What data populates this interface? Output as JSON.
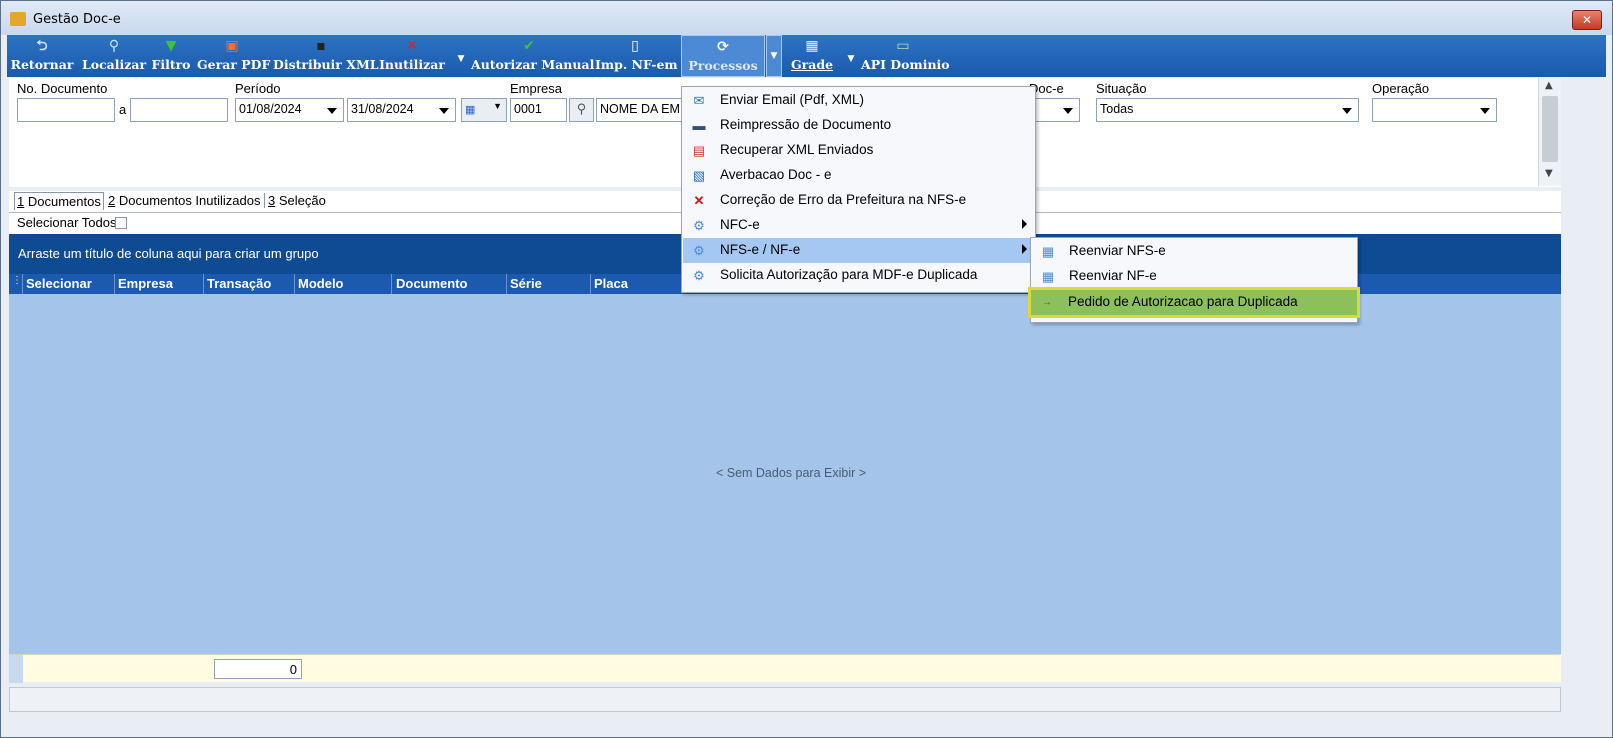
{
  "window": {
    "title": "Gestão Doc-e",
    "close_label": "✕"
  },
  "toolbar": {
    "buttons": [
      {
        "label": "Retornar",
        "icon": "undo-arrow-icon"
      },
      {
        "label": "Localizar",
        "icon": "magnifier-icon"
      },
      {
        "label": "Filtro",
        "icon": "funnel-icon"
      },
      {
        "label": "Gerar PDF",
        "icon": "pdf-icon"
      },
      {
        "label": "Distribuir XML",
        "icon": "floppy-disk-icon"
      },
      {
        "label": "Inutilizar",
        "icon": "red-x-icon"
      },
      {
        "label": "Autorizar Manual",
        "icon": "green-check-icon"
      },
      {
        "label": "Imp. NF-em",
        "icon": "document-icon"
      },
      {
        "label": "Processos",
        "icon": "refresh-cycle-icon"
      },
      {
        "label": "Grade",
        "icon": "grid-icon"
      },
      {
        "label": "API Dominio",
        "icon": "api-icon"
      }
    ]
  },
  "filters": {
    "no_documento_label": "No. Documento",
    "a_label": "a",
    "periodo_label": "Período",
    "periodo_inicio": "01/08/2024",
    "periodo_fim": "31/08/2024",
    "empresa_label": "Empresa",
    "empresa_codigo": "0001",
    "empresa_nome": "NOME DA EM",
    "doce_label": "Doc-e",
    "situacao_label": "Situação",
    "situacao_value": "Todas",
    "operacao_label": "Operação"
  },
  "tabs": [
    {
      "key": "1",
      "label": " Documentos"
    },
    {
      "key": "2",
      "label": " Documentos Inutilizados"
    },
    {
      "key": "3",
      "label": " Seleção"
    }
  ],
  "select_all_label": "Selecionar Todos",
  "group_hint": "Arraste um título de coluna aqui para criar um grupo",
  "columns": [
    "Selecionar",
    "Empresa",
    "Transação",
    "Modelo",
    "Documento",
    "Série",
    "Placa"
  ],
  "no_data": "< Sem Dados para Exibir >",
  "footer_count": "0",
  "processos_menu": [
    {
      "label": "Enviar Email (Pdf, XML)",
      "icon": "email-icon"
    },
    {
      "label": "Reimpressão de Documento",
      "icon": "printer-icon"
    },
    {
      "label": "Recuperar XML Enviados",
      "icon": "xml-recover-icon"
    },
    {
      "label": "Averbacao Doc - e",
      "icon": "document-gear-icon"
    },
    {
      "label": "Correção de Erro da Prefeitura na NFS-e",
      "icon": "red-x-icon"
    },
    {
      "label": "NFC-e",
      "icon": "gear-icon",
      "submenu": true
    },
    {
      "label": "NFS-e / NF-e",
      "icon": "gear-icon",
      "submenu": true,
      "highlighted": true
    },
    {
      "label": "Solicita Autorização para MDF-e Duplicada",
      "icon": "gear-icon"
    }
  ],
  "nfse_submenu": [
    {
      "label": "Reenviar NFS-e",
      "icon": "table-arrow-icon"
    },
    {
      "label": "Reenviar NF-e",
      "icon": "table-arrow-icon"
    },
    {
      "label": "Pedido de Autorizacao para Duplicada",
      "icon": "arrow-icon",
      "highlighted": true
    }
  ]
}
